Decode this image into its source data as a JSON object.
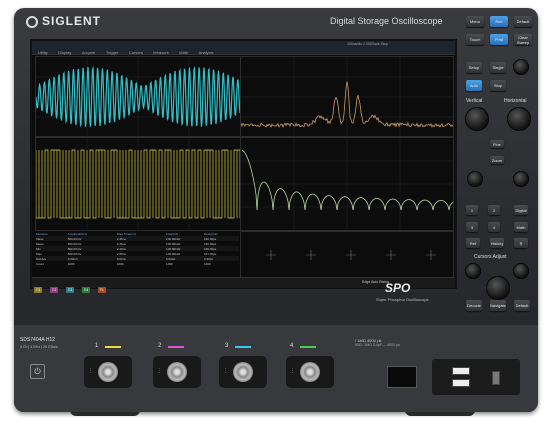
{
  "brand": "SIGLENT",
  "title": "Digital Storage Oscilloscope",
  "menu": [
    "Utility",
    "Display",
    "Acquire",
    "Trigger",
    "Cursors",
    "Measure",
    "Math",
    "Analysis"
  ],
  "header_info": [
    "100us/div",
    "2.00GSa/s",
    "Stop"
  ],
  "model": "SDS7404A H12",
  "model_sub": "4 Ch | 4 GHz | 20 GSa/s",
  "spd_logo": "SPO",
  "spd_sub": "Super Phosphor Oscilloscope",
  "channels": [
    "1",
    "2",
    "3",
    "4"
  ],
  "channel_colors": [
    "#e8d84a",
    "#d65ac8",
    "#3ac8e6",
    "#4cc85a"
  ],
  "measure_table": {
    "headers": [
      "Measure",
      "Amplitude(C1)",
      "Rise Time(C1)",
      "Freq(C2)",
      "Delay(C2)"
    ],
    "rows": [
      [
        "Value",
        "500.00mV",
        "2.45ns",
        "100.00kHz",
        "160.00ps"
      ],
      [
        "Mean",
        "500.00mV",
        "2.45ns",
        "100.00kHz",
        "160.00ps"
      ],
      [
        "Min",
        "500.00mV",
        "2.40ns",
        "100.00kHz",
        "159.00ps"
      ],
      [
        "Max",
        "500.00mV",
        "2.50ns",
        "100.00kHz",
        "161.00ps"
      ],
      [
        "Std.dev",
        "0.00mV",
        "0.02ns",
        "0.00Hz",
        "0.30ps"
      ],
      [
        "Count",
        "1000",
        "1000",
        "1000",
        "1000"
      ]
    ]
  },
  "status_badges": [
    "C1",
    "C2",
    "C3",
    "C4",
    "F1"
  ],
  "status_right": [
    "Edge",
    "Auto",
    "Rising"
  ],
  "panel": {
    "top_buttons": [
      "Menu",
      "Rec",
      "Default",
      "Touch",
      "Print",
      "Clear Sweep"
    ],
    "buttons_mid": [
      "Setup",
      "Single",
      "Auto",
      "Stop"
    ],
    "vertical_label": "Vertical",
    "horizontal_label": "Horizontal",
    "mid_buttons": [
      "Fine",
      "Zoom",
      "Search"
    ],
    "channel_buttons": [
      "1",
      "2",
      "3",
      "4"
    ],
    "side_buttons": [
      "Digital",
      "Math",
      "Ref",
      "History"
    ],
    "cursors_label": "Cursors Adjust",
    "bottom_buttons": [
      "Decode",
      "Navigate",
      "Default"
    ]
  },
  "front_info": "50Ω / 1MΩ 3.4pF — 400V pk",
  "front_warning": "!  1MΩ 400V pk"
}
